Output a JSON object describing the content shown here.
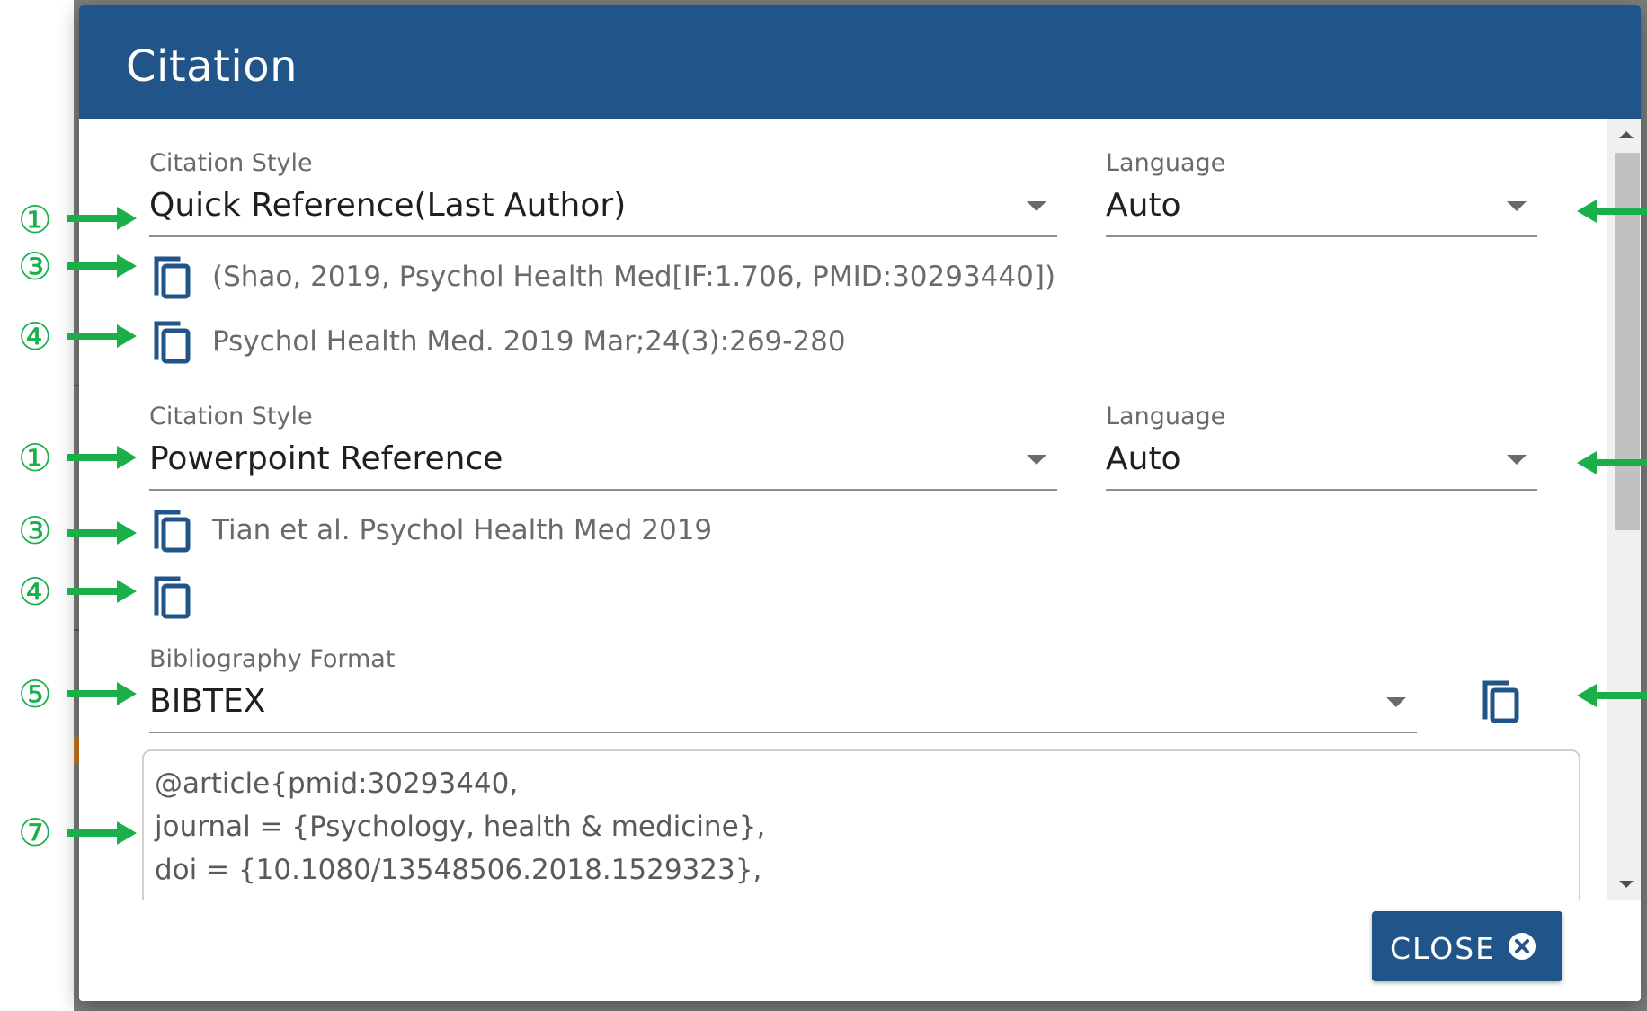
{
  "dialog": {
    "title": "Citation",
    "close_label": "CLOSE"
  },
  "citation_blocks": [
    {
      "style_label": "Citation Style",
      "style_value": "Quick Reference(Last Author)",
      "language_label": "Language",
      "language_value": "Auto",
      "lines": [
        "(Shao, 2019, Psychol Health Med[IF:1.706, PMID:30293440])",
        "Psychol Health Med. 2019 Mar;24(3):269-280"
      ]
    },
    {
      "style_label": "Citation Style",
      "style_value": "Powerpoint Reference",
      "language_label": "Language",
      "language_value": "Auto",
      "lines": [
        "Tian et al. Psychol Health Med 2019",
        ""
      ]
    }
  ],
  "bibliography": {
    "label": "Bibliography Format",
    "value": "BIBTEX",
    "text_lines": [
      "@article{pmid:30293440,",
      "journal = {Psychology, health & medicine},",
      "doi = {10.1080/13548506.2018.1529323},"
    ]
  },
  "annotations": {
    "markers": [
      "①",
      "③",
      "④",
      "①",
      "③",
      "④",
      "⑤",
      "⑦"
    ],
    "arrow_color": "#19b04a"
  },
  "colors": {
    "header": "#215488",
    "button": "#215488",
    "icon": "#215488"
  },
  "icons": {
    "copy": "copy-icon",
    "dropdown": "chevron-down-icon",
    "close": "close-circle-icon"
  }
}
